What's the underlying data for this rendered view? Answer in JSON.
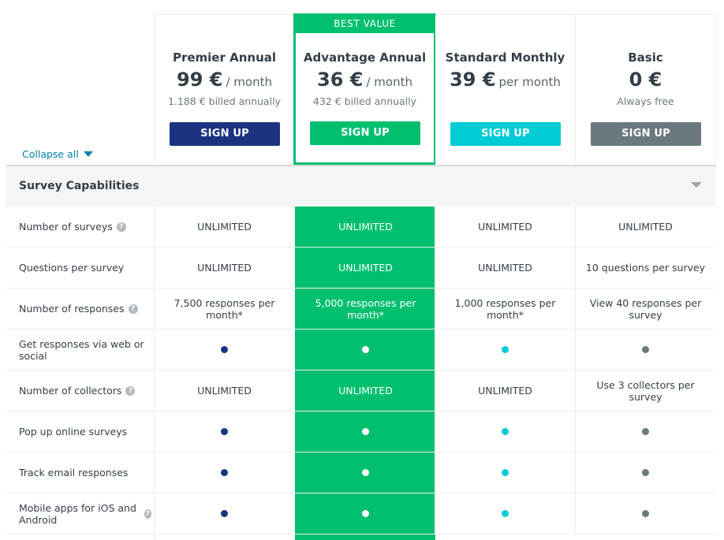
{
  "controls": {
    "collapse_all": "Collapse all"
  },
  "plans": [
    {
      "name": "Premier Annual",
      "price": "99 €",
      "period": "/ month",
      "billing": "1.188 € billed annually",
      "button": "SIGN UP",
      "color": "#1b3380",
      "featured": false
    },
    {
      "name": "Advantage Annual",
      "price": "36 €",
      "period": "/ month",
      "billing": "432 € billed annually",
      "button": "SIGN UP",
      "color": "#00bf6f",
      "featured": true,
      "badge": "BEST VALUE"
    },
    {
      "name": "Standard Monthly",
      "price": "39 €",
      "period": "per month",
      "billing": "",
      "button": "SIGN UP",
      "color": "#00ccd6",
      "featured": false
    },
    {
      "name": "Basic",
      "price": "0 €",
      "period": "",
      "billing": "Always free",
      "button": "SIGN UP",
      "color": "#6b787f",
      "featured": false
    }
  ],
  "section": {
    "title": "Survey Capabilities"
  },
  "dot_colors": [
    "#1b3380",
    "#ffffff",
    "#00ccd6",
    "#6b787f"
  ],
  "features": [
    {
      "label": "Number of surveys",
      "help": true,
      "values": [
        "UNLIMITED",
        "UNLIMITED",
        "UNLIMITED",
        "UNLIMITED"
      ]
    },
    {
      "label": "Questions per survey",
      "help": false,
      "values": [
        "UNLIMITED",
        "UNLIMITED",
        "UNLIMITED",
        "10 questions per survey"
      ]
    },
    {
      "label": "Number of responses",
      "help": true,
      "values": [
        "7,500 responses per month*",
        "5,000 responses per month*",
        "1,000 responses per month*",
        "View 40 responses per survey"
      ]
    },
    {
      "label": "Get responses via web or social",
      "help": false,
      "values": [
        "dot",
        "dot",
        "dot",
        "dot"
      ]
    },
    {
      "label": "Number of collectors",
      "help": true,
      "values": [
        "UNLIMITED",
        "UNLIMITED",
        "UNLIMITED",
        "Use 3 collectors per survey"
      ]
    },
    {
      "label": "Pop up online surveys",
      "help": false,
      "values": [
        "dot",
        "dot",
        "dot",
        "dot"
      ]
    },
    {
      "label": "Track email responses",
      "help": false,
      "values": [
        "dot",
        "dot",
        "dot",
        "dot"
      ]
    },
    {
      "label": "Mobile apps for iOS and Android",
      "help": true,
      "values": [
        "dot",
        "dot",
        "dot",
        "dot"
      ]
    }
  ]
}
